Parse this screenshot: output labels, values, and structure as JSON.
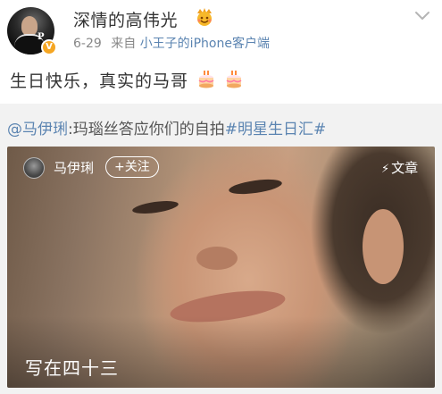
{
  "post": {
    "username": "深情的高伟光",
    "verified_badge": "V",
    "vip_icon": "crown-face-icon",
    "date": "6-29",
    "source_prefix": "来自",
    "source_name": "小王子的iPhone客户端",
    "text": "生日快乐，真实的马哥",
    "emojis": [
      "birthday-cake-icon",
      "birthday-cake-icon"
    ]
  },
  "repost": {
    "mention": "@马伊琍",
    "text": ":玛瑙丝答应你们的自拍",
    "topic": "#明星生日汇#"
  },
  "card": {
    "author": "马伊琍",
    "follow_label": "+关注",
    "article_label": "文章",
    "title": "写在四十三"
  },
  "colors": {
    "link": "#5b84b1",
    "meta_gray": "#888888",
    "repost_bg": "#f2f2f2",
    "badge_orange": "#f5a623"
  }
}
